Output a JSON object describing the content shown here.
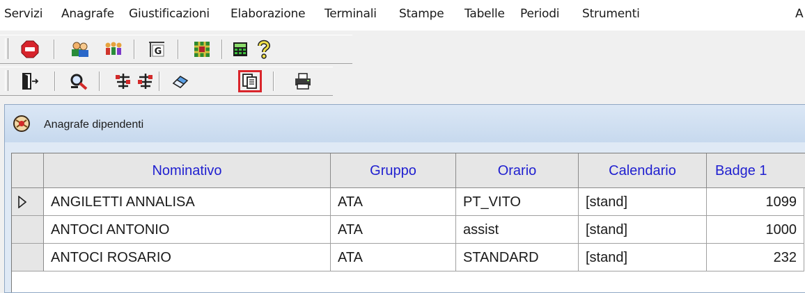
{
  "menubar": {
    "items": [
      {
        "label": "Servizi"
      },
      {
        "label": "Anagrafe"
      },
      {
        "label": "Giustificazioni"
      },
      {
        "label": "Elaborazione"
      },
      {
        "label": "Terminali"
      },
      {
        "label": "Stampe"
      },
      {
        "label": "Tabelle"
      },
      {
        "label": "Periodi"
      },
      {
        "label": "Strumenti"
      },
      {
        "label": "A"
      }
    ]
  },
  "toolbar1": {
    "buttons": [
      {
        "icon": "stop-icon"
      },
      {
        "icon": "users-icon"
      },
      {
        "icon": "group-icon"
      },
      {
        "icon": "g-letter-icon"
      },
      {
        "icon": "grid-pattern-icon"
      },
      {
        "icon": "calculator-icon"
      },
      {
        "icon": "help-icon"
      }
    ]
  },
  "toolbar2": {
    "buttons": [
      {
        "icon": "exit-door-icon"
      },
      {
        "icon": "search-magnifier-icon"
      },
      {
        "icon": "tree-expand-icon"
      },
      {
        "icon": "tree-collapse-icon"
      },
      {
        "icon": "eraser-icon"
      },
      {
        "icon": "copy-document-icon",
        "highlighted": true
      },
      {
        "icon": "printer-icon"
      }
    ]
  },
  "colors": {
    "highlight": "#d9252b",
    "header_text": "#1f1fd0",
    "title_bar": "#c7d9ee"
  },
  "window": {
    "title": "Anagrafe dipendenti",
    "icon": "app-window-icon"
  },
  "table": {
    "columns": [
      "Nominativo",
      "Gruppo",
      "Orario",
      "Calendario",
      "Badge 1"
    ],
    "rows": [
      {
        "nominativo": "ANGILETTI  ANNALISA",
        "gruppo": "ATA",
        "orario": "PT_VITO",
        "calendario": "[stand]",
        "badge1": "1099",
        "current": true
      },
      {
        "nominativo": "ANTOCI  ANTONIO",
        "gruppo": "ATA",
        "orario": "assist",
        "calendario": "[stand]",
        "badge1": "1000"
      },
      {
        "nominativo": "ANTOCI  ROSARIO",
        "gruppo": "ATA",
        "orario": "STANDARD",
        "calendario": "[stand]",
        "badge1": "232"
      }
    ]
  }
}
